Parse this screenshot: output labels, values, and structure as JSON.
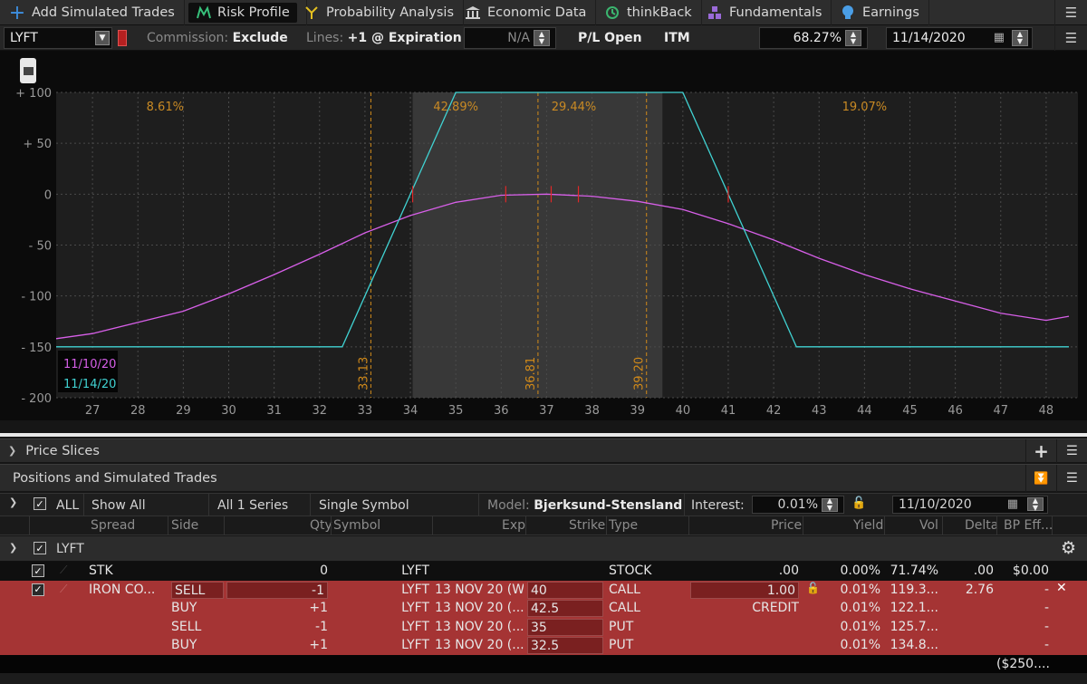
{
  "tabs": [
    {
      "label": "Add Simulated Trades",
      "icon": "plus-icon"
    },
    {
      "label": "Risk Profile",
      "icon": "risk-profile-icon"
    },
    {
      "label": "Probability Analysis",
      "icon": "probability-icon"
    },
    {
      "label": "Economic Data",
      "icon": "bank-icon"
    },
    {
      "label": "thinkBack",
      "icon": "history-icon"
    },
    {
      "label": "Fundamentals",
      "icon": "fundamentals-icon"
    },
    {
      "label": "Earnings",
      "icon": "lightbulb-icon"
    }
  ],
  "settings": {
    "symbol": "LYFT",
    "commission_label": "Commission:",
    "commission_value": "Exclude",
    "lines_label": "Lines:",
    "lines_value": "+1 @ Expiration",
    "na_value": "N/A",
    "pl_mode": "P/L Open",
    "itm": "ITM",
    "percent": "68.27%",
    "date": "11/14/2020"
  },
  "chart_data": {
    "type": "line",
    "xlabel": "",
    "ylabel": "",
    "xlim": [
      26.2,
      48.7
    ],
    "ylim": [
      -200,
      100
    ],
    "x_ticks": [
      27,
      28,
      29,
      30,
      31,
      32,
      33,
      34,
      35,
      36,
      37,
      38,
      39,
      40,
      41,
      42,
      43,
      44,
      45,
      46,
      47,
      48
    ],
    "y_ticks": [
      100,
      50,
      0,
      -50,
      -100,
      -150,
      -200
    ],
    "y_tick_labels": [
      "+ 100",
      "+ 50",
      "0",
      "- 50",
      "- 100",
      "- 150",
      "- 200"
    ],
    "shaded_range": [
      34.05,
      39.55
    ],
    "vertical_markers": [
      {
        "x": 33.13,
        "label": "33.13"
      },
      {
        "x": 36.81,
        "label": "36.81"
      },
      {
        "x": 39.2,
        "label": "39.20"
      }
    ],
    "probability_labels": [
      {
        "x": 28.6,
        "label": "8.61%"
      },
      {
        "x": 35.0,
        "label": "42.89%"
      },
      {
        "x": 37.6,
        "label": "29.44%"
      },
      {
        "x": 44.0,
        "label": "19.07%"
      }
    ],
    "series": [
      {
        "name": "11/10/20",
        "color": "#d75fe8",
        "points": [
          [
            26.2,
            -142
          ],
          [
            27,
            -137
          ],
          [
            28,
            -126
          ],
          [
            29,
            -115
          ],
          [
            30,
            -98
          ],
          [
            31,
            -79
          ],
          [
            32,
            -59
          ],
          [
            33,
            -38
          ],
          [
            34,
            -21
          ],
          [
            35,
            -8
          ],
          [
            36,
            -1
          ],
          [
            37,
            0
          ],
          [
            38,
            -2
          ],
          [
            39,
            -7
          ],
          [
            40,
            -15
          ],
          [
            41,
            -29
          ],
          [
            42,
            -45
          ],
          [
            43,
            -63
          ],
          [
            44,
            -79
          ],
          [
            45,
            -93
          ],
          [
            46,
            -105
          ],
          [
            47,
            -117
          ],
          [
            48,
            -124
          ],
          [
            48.5,
            -120
          ]
        ]
      },
      {
        "name": "11/14/20",
        "color": "#40d2d2",
        "points": [
          [
            26.2,
            -150
          ],
          [
            32.5,
            -150
          ],
          [
            35,
            100
          ],
          [
            40,
            100
          ],
          [
            42.5,
            -150
          ],
          [
            48.5,
            -150
          ]
        ]
      }
    ],
    "legend": [
      "11/10/20",
      "11/14/20"
    ],
    "legend_position": "bottom-left"
  },
  "panels": {
    "price_slices": "Price Slices",
    "positions": "Positions and Simulated Trades"
  },
  "filters": {
    "all": "ALL",
    "show": "Show All",
    "series": "All 1 Series",
    "symbol_mode": "Single Symbol",
    "model_label": "Model:",
    "model_value": "Bjerksund-Stensland",
    "interest_label": "Interest:",
    "interest_value": "0.01%",
    "date": "11/10/2020"
  },
  "columns": [
    "Spread",
    "Side",
    "Qty",
    "Symbol",
    "Exp",
    "Strike",
    "Type",
    "Price",
    "Yield",
    "Vol",
    "Delta",
    "BP Eff..."
  ],
  "group": {
    "label": "LYFT"
  },
  "rows": [
    {
      "spread": "STK",
      "side": "",
      "qty": "0",
      "symbol": "LYFT",
      "exp": "",
      "strike": "",
      "type": "STOCK",
      "price": ".00",
      "yield": "0.00%",
      "vol": "71.74%",
      "delta": ".00",
      "bp": "$0.00",
      "style": "dark"
    },
    {
      "spread": "IRON CO...",
      "side": "SELL",
      "qty": "-1",
      "symbol": "LYFT",
      "exp": "13 NOV 20 (W...",
      "strike": "40",
      "type": "CALL",
      "price": "1.00",
      "yield": "0.01%",
      "vol": "119.3...",
      "delta": "2.76",
      "bp": "-",
      "style": "red"
    },
    {
      "spread": "",
      "side": "BUY",
      "qty": "+1",
      "symbol": "LYFT",
      "exp": "13 NOV 20 (...",
      "strike": "42.5",
      "type": "CALL",
      "price": "CREDIT",
      "yield": "0.01%",
      "vol": "122.1...",
      "delta": "",
      "bp": "-",
      "style": "red"
    },
    {
      "spread": "",
      "side": "SELL",
      "qty": "-1",
      "symbol": "LYFT",
      "exp": "13 NOV 20 (...",
      "strike": "35",
      "type": "PUT",
      "price": "",
      "yield": "0.01%",
      "vol": "125.7...",
      "delta": "",
      "bp": "-",
      "style": "red"
    },
    {
      "spread": "",
      "side": "BUY",
      "qty": "+1",
      "symbol": "LYFT",
      "exp": "13 NOV 20 (...",
      "strike": "32.5",
      "type": "PUT",
      "price": "",
      "yield": "0.01%",
      "vol": "134.8...",
      "delta": "",
      "bp": "-",
      "style": "red"
    }
  ],
  "total_bp": "($250...."
}
